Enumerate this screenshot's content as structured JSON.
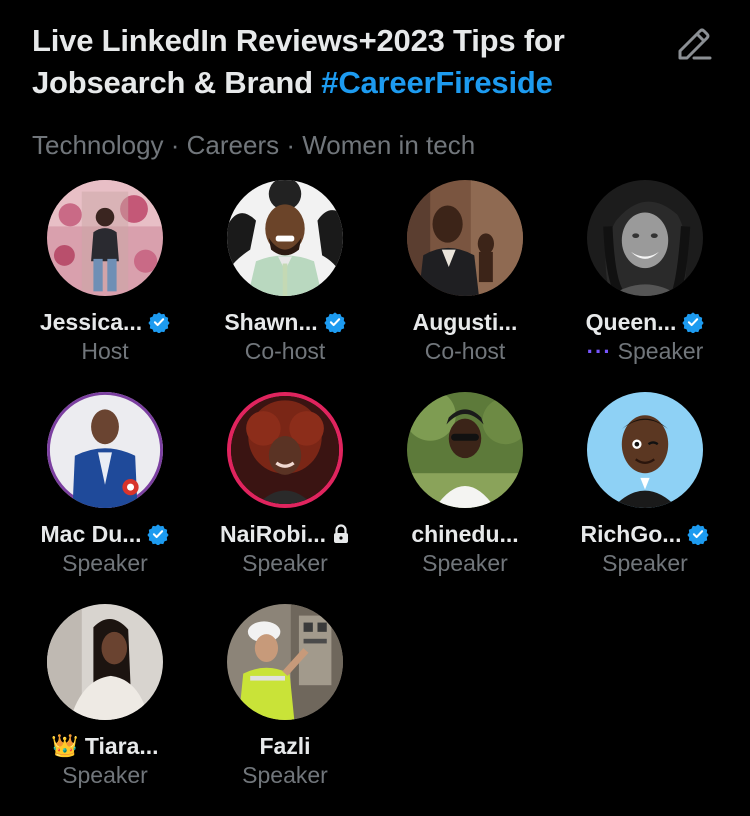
{
  "space": {
    "title_text": "Live LinkedIn Reviews+2023 Tips for Jobsearch & Brand",
    "hashtag": "#CareerFireside",
    "topics": "Technology · Careers · Women in tech"
  },
  "icons": {
    "edit": "pencil-edit-icon",
    "verified": "verified-badge-icon",
    "lock": "lock-icon",
    "speaking": "speaking-dots-icon",
    "crown": "crown-emoji"
  },
  "colors": {
    "background": "#000000",
    "text": "#e7e9ea",
    "muted": "#71767b",
    "accent": "#1d9bf0",
    "speaking": "#7856ff",
    "ring": "#e0245e"
  },
  "participants": [
    {
      "name": "Jessica...",
      "role": "Host",
      "verified": true,
      "lock": false,
      "speaking": false,
      "crown": false
    },
    {
      "name": "Shawn...",
      "role": "Co-host",
      "verified": true,
      "lock": false,
      "speaking": false,
      "crown": false
    },
    {
      "name": "Augusti...",
      "role": "Co-host",
      "verified": false,
      "lock": false,
      "speaking": false,
      "crown": false
    },
    {
      "name": "Queen...",
      "role": "Speaker",
      "verified": true,
      "lock": false,
      "speaking": true,
      "speaking_mark": "···",
      "crown": false
    },
    {
      "name": "Mac Du...",
      "role": "Speaker",
      "verified": true,
      "lock": false,
      "speaking": false,
      "crown": false
    },
    {
      "name": "NaiRobi...",
      "role": "Speaker",
      "verified": false,
      "lock": true,
      "speaking": false,
      "crown": false,
      "ring": true
    },
    {
      "name": "chinedu...",
      "role": "Speaker",
      "verified": false,
      "lock": false,
      "speaking": false,
      "crown": false
    },
    {
      "name": "RichGo...",
      "role": "Speaker",
      "verified": true,
      "lock": false,
      "speaking": false,
      "crown": false
    },
    {
      "name": "Tiara...",
      "role": "Speaker",
      "verified": false,
      "lock": false,
      "speaking": false,
      "crown": true,
      "crown_glyph": "👑"
    },
    {
      "name": "Fazli",
      "role": "Speaker",
      "verified": false,
      "lock": false,
      "speaking": false,
      "crown": false
    }
  ]
}
